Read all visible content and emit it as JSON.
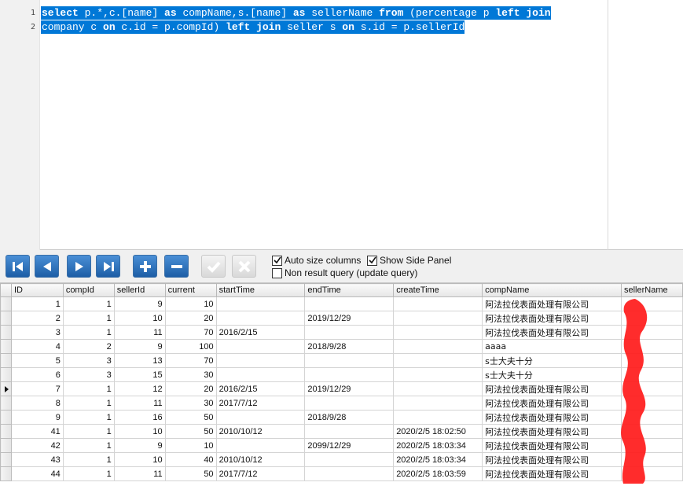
{
  "editor": {
    "line_numbers": [
      "1",
      "2"
    ],
    "line1": [
      {
        "t": "select",
        "kw": true
      },
      {
        "t": " p.*,c.[name] "
      },
      {
        "t": "as",
        "kw": true
      },
      {
        "t": " compName,s.[name] "
      },
      {
        "t": "as",
        "kw": true
      },
      {
        "t": " sellerName "
      },
      {
        "t": "from",
        "kw": true
      },
      {
        "t": " (percentage p "
      },
      {
        "t": "left join",
        "kw": true
      }
    ],
    "line2": [
      {
        "t": "company c "
      },
      {
        "t": "on",
        "kw": true
      },
      {
        "t": " c.id = p.compId) "
      },
      {
        "t": "left join",
        "kw": true
      },
      {
        "t": " seller s "
      },
      {
        "t": "on",
        "kw": true
      },
      {
        "t": " s.id = p.sellerId"
      }
    ]
  },
  "toolbar": {
    "buttons": [
      "first-record",
      "previous-record",
      "next-record",
      "last-record",
      "add-record",
      "delete-record",
      "post-edit",
      "cancel-edit"
    ],
    "auto_size_label": "Auto size columns",
    "auto_size_checked": true,
    "side_panel_label": "Show Side Panel",
    "side_panel_checked": true,
    "non_result_label": "Non result query (update query)",
    "non_result_checked": false
  },
  "grid": {
    "columns": [
      "ID",
      "compId",
      "sellerId",
      "current",
      "startTime",
      "endTime",
      "createTime",
      "compName",
      "sellerName"
    ],
    "current_row": 6,
    "rows": [
      [
        "1",
        "1",
        "9",
        "10",
        "",
        "",
        "",
        "阿法拉伐表面处理有限公司",
        ""
      ],
      [
        "2",
        "1",
        "10",
        "20",
        "",
        "2019/12/29",
        "",
        "阿法拉伐表面处理有限公司",
        ""
      ],
      [
        "3",
        "1",
        "11",
        "70",
        "2016/2/15",
        "",
        "",
        "阿法拉伐表面处理有限公司",
        ""
      ],
      [
        "4",
        "2",
        "9",
        "100",
        "",
        "2018/9/28",
        "",
        "aaaa",
        ""
      ],
      [
        "5",
        "3",
        "13",
        "70",
        "",
        "",
        "",
        "s士大夫十分",
        ""
      ],
      [
        "6",
        "3",
        "15",
        "30",
        "",
        "",
        "",
        "s士大夫十分",
        ""
      ],
      [
        "7",
        "1",
        "12",
        "20",
        "2016/2/15",
        "2019/12/29",
        "",
        "阿法拉伐表面处理有限公司",
        ""
      ],
      [
        "8",
        "1",
        "11",
        "30",
        "2017/7/12",
        "",
        "",
        "阿法拉伐表面处理有限公司",
        ""
      ],
      [
        "9",
        "1",
        "16",
        "50",
        "",
        "2018/9/28",
        "",
        "阿法拉伐表面处理有限公司",
        ""
      ],
      [
        "41",
        "1",
        "10",
        "50",
        "2010/10/12",
        "",
        "2020/2/5 18:02:50",
        "阿法拉伐表面处理有限公司",
        ""
      ],
      [
        "42",
        "1",
        "9",
        "10",
        "",
        "2099/12/29",
        "2020/2/5 18:03:34",
        "阿法拉伐表面处理有限公司",
        ""
      ],
      [
        "43",
        "1",
        "10",
        "40",
        "2010/10/12",
        "",
        "2020/2/5 18:03:34",
        "阿法拉伐表面处理有限公司",
        ""
      ],
      [
        "44",
        "1",
        "11",
        "50",
        "2017/7/12",
        "",
        "2020/2/5 18:03:59",
        "阿法拉伐表面处理有限公司",
        ""
      ]
    ]
  },
  "colors": {
    "selection": "#0078d7",
    "nav_button": "#2b6cb5",
    "redaction": "#ff1a1a"
  }
}
